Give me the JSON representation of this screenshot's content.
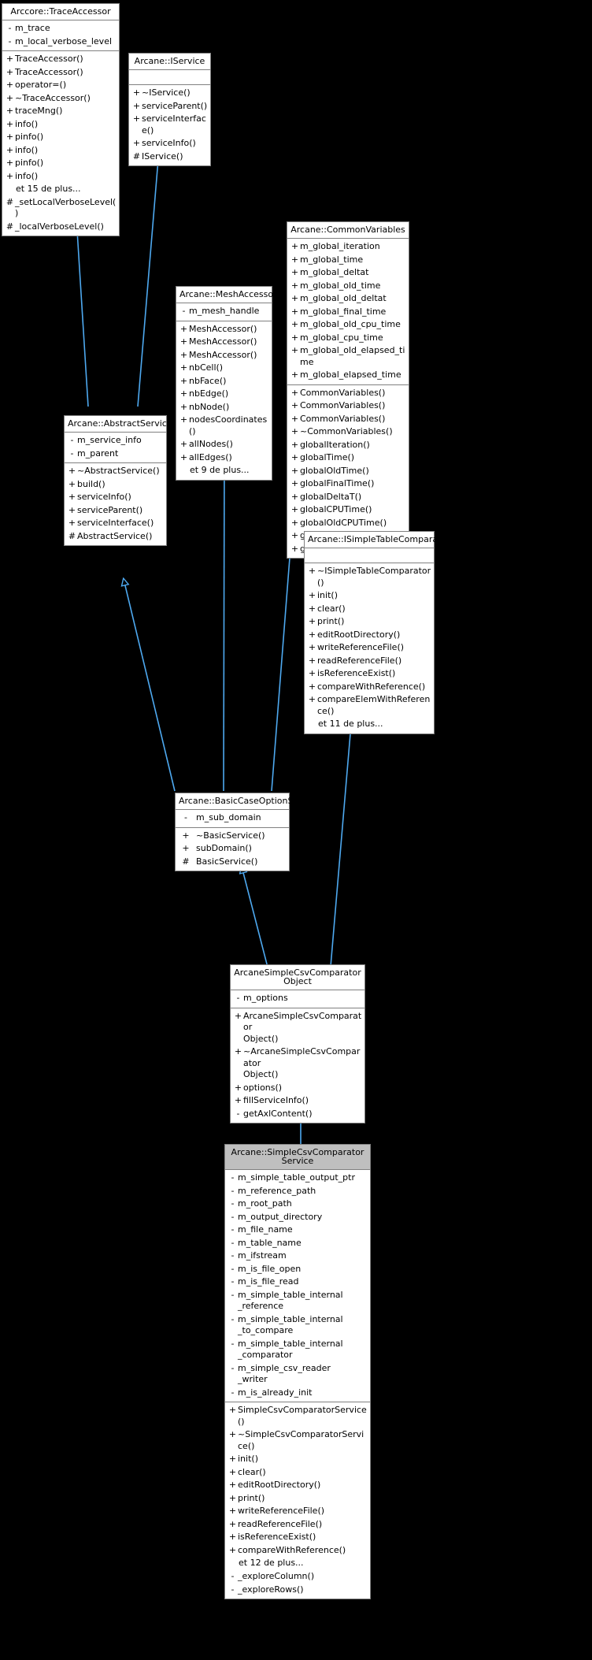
{
  "diagram": {
    "kind": "uml-class-inheritance-diagram",
    "language": "fr",
    "more_label_prefix": "et",
    "background_color": "#000000",
    "node_fill": "#ffffff",
    "node_border": "#808080",
    "focus_header_fill": "#bfbfbf",
    "edge_color": "#4ea9f0"
  },
  "nodes": [
    {
      "id": "trace_accessor",
      "title": "Arccore::TraceAccessor",
      "focus": false,
      "attributes": [
        {
          "vis": "-",
          "name": "m_trace"
        },
        {
          "vis": "-",
          "name": "m_local_verbose_level"
        }
      ],
      "operations": [
        {
          "vis": "+",
          "name": "TraceAccessor()"
        },
        {
          "vis": "+",
          "name": "TraceAccessor()"
        },
        {
          "vis": "+",
          "name": "operator=()"
        },
        {
          "vis": "+",
          "name": "~TraceAccessor()"
        },
        {
          "vis": "+",
          "name": "traceMng()"
        },
        {
          "vis": "+",
          "name": "info()"
        },
        {
          "vis": "+",
          "name": "pinfo()"
        },
        {
          "vis": "+",
          "name": "info()"
        },
        {
          "vis": "+",
          "name": "pinfo()"
        },
        {
          "vis": "+",
          "name": "info()"
        },
        {
          "vis": "",
          "name": "et 15 de plus..."
        },
        {
          "vis": "#",
          "name": "_setLocalVerboseLevel()"
        },
        {
          "vis": "#",
          "name": "_localVerboseLevel()"
        }
      ]
    },
    {
      "id": "iservice",
      "title": "Arcane::IService",
      "focus": false,
      "attributes": [],
      "operations": [
        {
          "vis": "+",
          "name": "~IService()"
        },
        {
          "vis": "+",
          "name": "serviceParent()"
        },
        {
          "vis": "+",
          "name": "serviceInterface()"
        },
        {
          "vis": "+",
          "name": "serviceInfo()"
        },
        {
          "vis": "#",
          "name": "IService()"
        }
      ]
    },
    {
      "id": "abstract_service",
      "title": "Arcane::AbstractService",
      "focus": false,
      "attributes": [
        {
          "vis": "-",
          "name": "m_service_info"
        },
        {
          "vis": "-",
          "name": "m_parent"
        }
      ],
      "operations": [
        {
          "vis": "+",
          "name": "~AbstractService()"
        },
        {
          "vis": "+",
          "name": "build()"
        },
        {
          "vis": "+",
          "name": "serviceInfo()"
        },
        {
          "vis": "+",
          "name": "serviceParent()"
        },
        {
          "vis": "+",
          "name": "serviceInterface()"
        },
        {
          "vis": "#",
          "name": "AbstractService()"
        }
      ]
    },
    {
      "id": "mesh_accessor",
      "title": "Arcane::MeshAccessor",
      "focus": false,
      "attributes": [
        {
          "vis": "-",
          "name": "m_mesh_handle"
        }
      ],
      "operations": [
        {
          "vis": "+",
          "name": "MeshAccessor()"
        },
        {
          "vis": "+",
          "name": "MeshAccessor()"
        },
        {
          "vis": "+",
          "name": "MeshAccessor()"
        },
        {
          "vis": "+",
          "name": "nbCell()"
        },
        {
          "vis": "+",
          "name": "nbFace()"
        },
        {
          "vis": "+",
          "name": "nbEdge()"
        },
        {
          "vis": "+",
          "name": "nbNode()"
        },
        {
          "vis": "+",
          "name": "nodesCoordinates()"
        },
        {
          "vis": "+",
          "name": "allNodes()"
        },
        {
          "vis": "+",
          "name": "allEdges()"
        },
        {
          "vis": "",
          "name": "et 9 de plus..."
        }
      ]
    },
    {
      "id": "common_variables",
      "title": "Arcane::CommonVariables",
      "focus": false,
      "attributes": [
        {
          "vis": "+",
          "name": "m_global_iteration"
        },
        {
          "vis": "+",
          "name": "m_global_time"
        },
        {
          "vis": "+",
          "name": "m_global_deltat"
        },
        {
          "vis": "+",
          "name": "m_global_old_time"
        },
        {
          "vis": "+",
          "name": "m_global_old_deltat"
        },
        {
          "vis": "+",
          "name": "m_global_final_time"
        },
        {
          "vis": "+",
          "name": "m_global_old_cpu_time"
        },
        {
          "vis": "+",
          "name": "m_global_cpu_time"
        },
        {
          "vis": "+",
          "name": "m_global_old_elapsed_time"
        },
        {
          "vis": "+",
          "name": "m_global_elapsed_time"
        }
      ],
      "operations": [
        {
          "vis": "+",
          "name": "CommonVariables()"
        },
        {
          "vis": "+",
          "name": "CommonVariables()"
        },
        {
          "vis": "+",
          "name": "CommonVariables()"
        },
        {
          "vis": "+",
          "name": "~CommonVariables()"
        },
        {
          "vis": "+",
          "name": "globalIteration()"
        },
        {
          "vis": "+",
          "name": "globalTime()"
        },
        {
          "vis": "+",
          "name": "globalOldTime()"
        },
        {
          "vis": "+",
          "name": "globalFinalTime()"
        },
        {
          "vis": "+",
          "name": "globalDeltaT()"
        },
        {
          "vis": "+",
          "name": "globalCPUTime()"
        },
        {
          "vis": "+",
          "name": "globalOldCPUTime()"
        },
        {
          "vis": "+",
          "name": "globalElapsedTime()"
        },
        {
          "vis": "+",
          "name": "globalOldElapsedTime()"
        }
      ]
    },
    {
      "id": "basic_case_option_service",
      "title": "Arcane::BasicCaseOptionService",
      "focus": false,
      "centered": true,
      "attributes": [
        {
          "vis": "-",
          "name": "m_sub_domain"
        }
      ],
      "operations": [
        {
          "vis": "+",
          "name": "~BasicService()"
        },
        {
          "vis": "+",
          "name": "subDomain()"
        },
        {
          "vis": "#",
          "name": "BasicService()"
        }
      ]
    },
    {
      "id": "isimple_table_comparator",
      "title": "Arcane::ISimpleTableComparator",
      "focus": false,
      "attributes": [],
      "operations": [
        {
          "vis": "+",
          "name": "~ISimpleTableComparator()"
        },
        {
          "vis": "+",
          "name": "init()"
        },
        {
          "vis": "+",
          "name": "clear()"
        },
        {
          "vis": "+",
          "name": "print()"
        },
        {
          "vis": "+",
          "name": "editRootDirectory()"
        },
        {
          "vis": "+",
          "name": "writeReferenceFile()"
        },
        {
          "vis": "+",
          "name": "readReferenceFile()"
        },
        {
          "vis": "+",
          "name": "isReferenceExist()"
        },
        {
          "vis": "+",
          "name": "compareWithReference()"
        },
        {
          "vis": "+",
          "name": "compareElemWithReference()"
        },
        {
          "vis": "",
          "name": "et 11 de plus..."
        }
      ]
    },
    {
      "id": "arcane_simple_csv_comparator_object",
      "title": "ArcaneSimpleCsvComparator\nObject",
      "focus": false,
      "attributes": [
        {
          "vis": "-",
          "name": "m_options"
        }
      ],
      "operations": [
        {
          "vis": "+",
          "name": "ArcaneSimpleCsvComparator\nObject()"
        },
        {
          "vis": "+",
          "name": "~ArcaneSimpleCsvComparator\nObject()"
        },
        {
          "vis": "+",
          "name": "options()"
        },
        {
          "vis": "+",
          "name": "fillServiceInfo()"
        },
        {
          "vis": "-",
          "name": "getAxlContent()"
        }
      ]
    },
    {
      "id": "simple_csv_comparator_service",
      "title": "Arcane::SimpleCsvComparator\nService",
      "focus": true,
      "attributes": [
        {
          "vis": "-",
          "name": "m_simple_table_output_ptr"
        },
        {
          "vis": "-",
          "name": "m_reference_path"
        },
        {
          "vis": "-",
          "name": "m_root_path"
        },
        {
          "vis": "-",
          "name": "m_output_directory"
        },
        {
          "vis": "-",
          "name": "m_file_name"
        },
        {
          "vis": "-",
          "name": "m_table_name"
        },
        {
          "vis": "-",
          "name": "m_ifstream"
        },
        {
          "vis": "-",
          "name": "m_is_file_open"
        },
        {
          "vis": "-",
          "name": "m_is_file_read"
        },
        {
          "vis": "-",
          "name": "m_simple_table_internal\n_reference"
        },
        {
          "vis": "-",
          "name": "m_simple_table_internal\n_to_compare"
        },
        {
          "vis": "-",
          "name": "m_simple_table_internal\n_comparator"
        },
        {
          "vis": "-",
          "name": "m_simple_csv_reader\n_writer"
        },
        {
          "vis": "-",
          "name": "m_is_already_init"
        }
      ],
      "operations": [
        {
          "vis": "+",
          "name": "SimpleCsvComparatorService()"
        },
        {
          "vis": "+",
          "name": "~SimpleCsvComparatorService()"
        },
        {
          "vis": "+",
          "name": "init()"
        },
        {
          "vis": "+",
          "name": "clear()"
        },
        {
          "vis": "+",
          "name": "editRootDirectory()"
        },
        {
          "vis": "+",
          "name": "print()"
        },
        {
          "vis": "+",
          "name": "writeReferenceFile()"
        },
        {
          "vis": "+",
          "name": "readReferenceFile()"
        },
        {
          "vis": "+",
          "name": "isReferenceExist()"
        },
        {
          "vis": "+",
          "name": "compareWithReference()"
        },
        {
          "vis": "",
          "name": "et 12 de plus..."
        },
        {
          "vis": "-",
          "name": "_exploreColumn()"
        },
        {
          "vis": "-",
          "name": "_exploreRows()"
        }
      ]
    }
  ],
  "edges": [
    {
      "from": "abstract_service",
      "to": "trace_accessor",
      "kind": "inheritance"
    },
    {
      "from": "abstract_service",
      "to": "iservice",
      "kind": "inheritance"
    },
    {
      "from": "basic_case_option_service",
      "to": "abstract_service",
      "kind": "inheritance"
    },
    {
      "from": "basic_case_option_service",
      "to": "mesh_accessor",
      "kind": "inheritance"
    },
    {
      "from": "basic_case_option_service",
      "to": "common_variables",
      "kind": "inheritance"
    },
    {
      "from": "arcane_simple_csv_comparator_object",
      "to": "basic_case_option_service",
      "kind": "inheritance"
    },
    {
      "from": "arcane_simple_csv_comparator_object",
      "to": "isimple_table_comparator",
      "kind": "inheritance"
    },
    {
      "from": "simple_csv_comparator_service",
      "to": "arcane_simple_csv_comparator_object",
      "kind": "inheritance"
    }
  ]
}
